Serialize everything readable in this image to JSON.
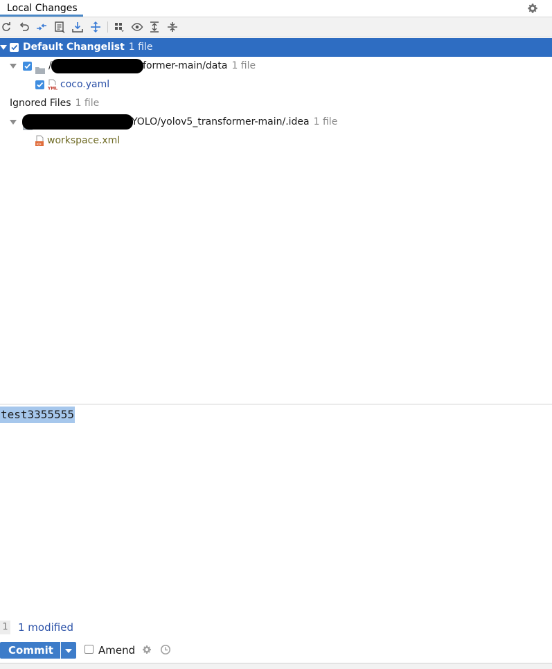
{
  "header": {
    "tab_label": "Local Changes"
  },
  "icons": {
    "settings": "gear-icon",
    "toolbar": [
      "refresh-icon",
      "rollback-icon",
      "show-diff-icon",
      "edit-source-icon",
      "shelve-icon",
      "unshelve-icon",
      "group-by-icon",
      "preview-icon",
      "expand-all-icon",
      "collapse-all-icon"
    ]
  },
  "changelists": [
    {
      "name": "Default Changelist",
      "count": "1 file"
    }
  ],
  "tree": {
    "changelist_folder": "/YOLO/yolov5_transformer-main/data",
    "changelist_folder_count": "1 file",
    "changelist_file": "coco.yaml",
    "ignored_label": "Ignored Files",
    "ignored_count": "1 file",
    "ignored_folder": "YOLO/yolov5_transformer-main/.idea",
    "ignored_folder_count": "1 file",
    "ignored_file": "workspace.xml"
  },
  "commit_message": "test3355555",
  "status": {
    "number": "1",
    "text": "1 modified"
  },
  "commit": {
    "button_label": "Commit",
    "amend_label": "Amend"
  },
  "colors": {
    "selection": "#2e6dc2",
    "accent": "#4a88c7",
    "link": "#284ea6",
    "ignored": "#6f6b25",
    "message_highlight": "#a6c7ec"
  }
}
